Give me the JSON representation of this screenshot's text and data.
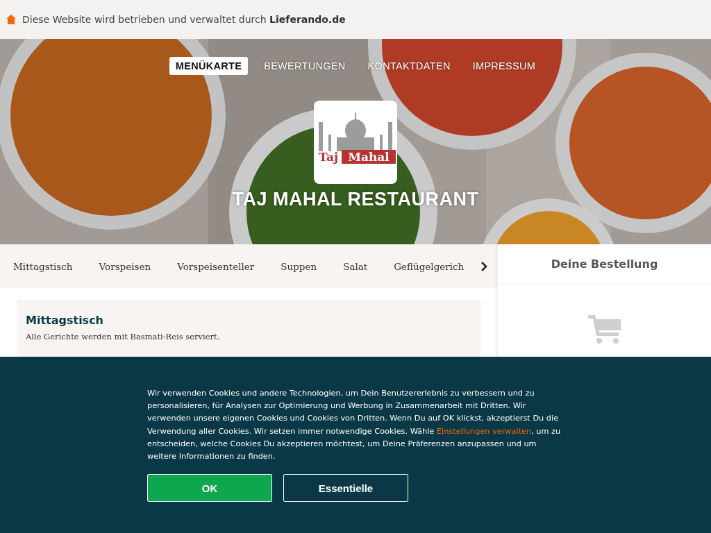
{
  "banner": {
    "text": "Diese Website wird betrieben und verwaltet durch",
    "brand": "Lieferando.de"
  },
  "nav": [
    {
      "label": "MENÜKARTE",
      "selected": true
    },
    {
      "label": "BEWERTUNGEN",
      "selected": false
    },
    {
      "label": "KONTAKTDATEN",
      "selected": false
    },
    {
      "label": "IMPRESSUM",
      "selected": false
    }
  ],
  "logo": {
    "word_1": "Taj",
    "word_2": "Mahal"
  },
  "restaurant_name": "TAJ MAHAL RESTAURANT",
  "categories": [
    "Mittagstisch",
    "Vorspeisen",
    "Vorspeisenteller",
    "Suppen",
    "Salat",
    "Geflügelgerich"
  ],
  "section": {
    "title": "Mittagstisch",
    "description": "Alle Gerichte werden mit Basmati-Reis serviert."
  },
  "order": {
    "title": "Deine Bestellung"
  },
  "cookie": {
    "text_before": "Wir verwenden Cookies und andere Technologien, um Dein Benutzererlebnis zu verbessern und zu personalisieren, für Analysen zur Optimierung und Werbung in Zusammenarbeit mit Dritten. Wir verwenden unsere eigenen Cookies und Cookies von Dritten. Wenn Du auf OK klickst, akzeptierst Du die Verwendung aller Cookies. Wir setzen immer notwendige Cookies. Wähle",
    "link": "Einstellungen verwalten",
    "text_after": ", um zu entscheiden, welche Cookies Du akzeptieren möchtest, um Deine Präferenzen anzupassen und um weitere Informationen zu finden.",
    "buttons": [
      {
        "label": "OK",
        "kind": "primary"
      },
      {
        "label": "Essentielle",
        "kind": "outline"
      }
    ]
  }
}
